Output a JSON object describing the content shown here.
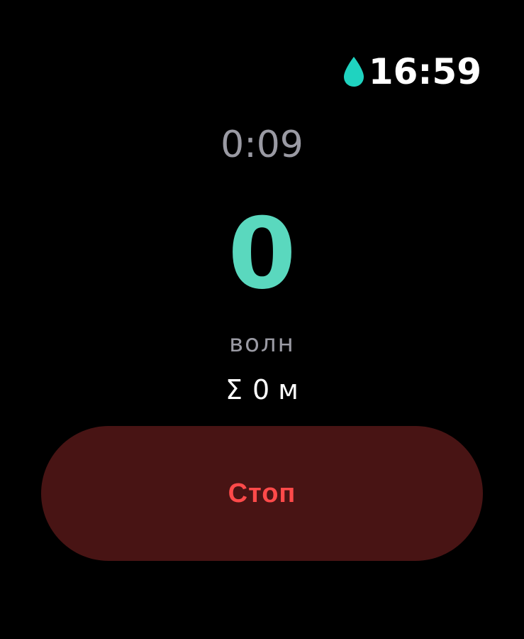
{
  "status": {
    "clock": "16:59",
    "icon": "water-drop-icon"
  },
  "workout": {
    "elapsed": "0:09",
    "waves": "0",
    "waves_label": "волн",
    "distance_symbol": "Σ",
    "distance_value": "0 м"
  },
  "actions": {
    "stop_label": "Стоп"
  },
  "colors": {
    "accent": "#5ad8be",
    "water_icon": "#1fd3c0",
    "stop_bg": "#481414",
    "stop_text": "#ff4a4a",
    "secondary_text": "#9a9aa3"
  }
}
